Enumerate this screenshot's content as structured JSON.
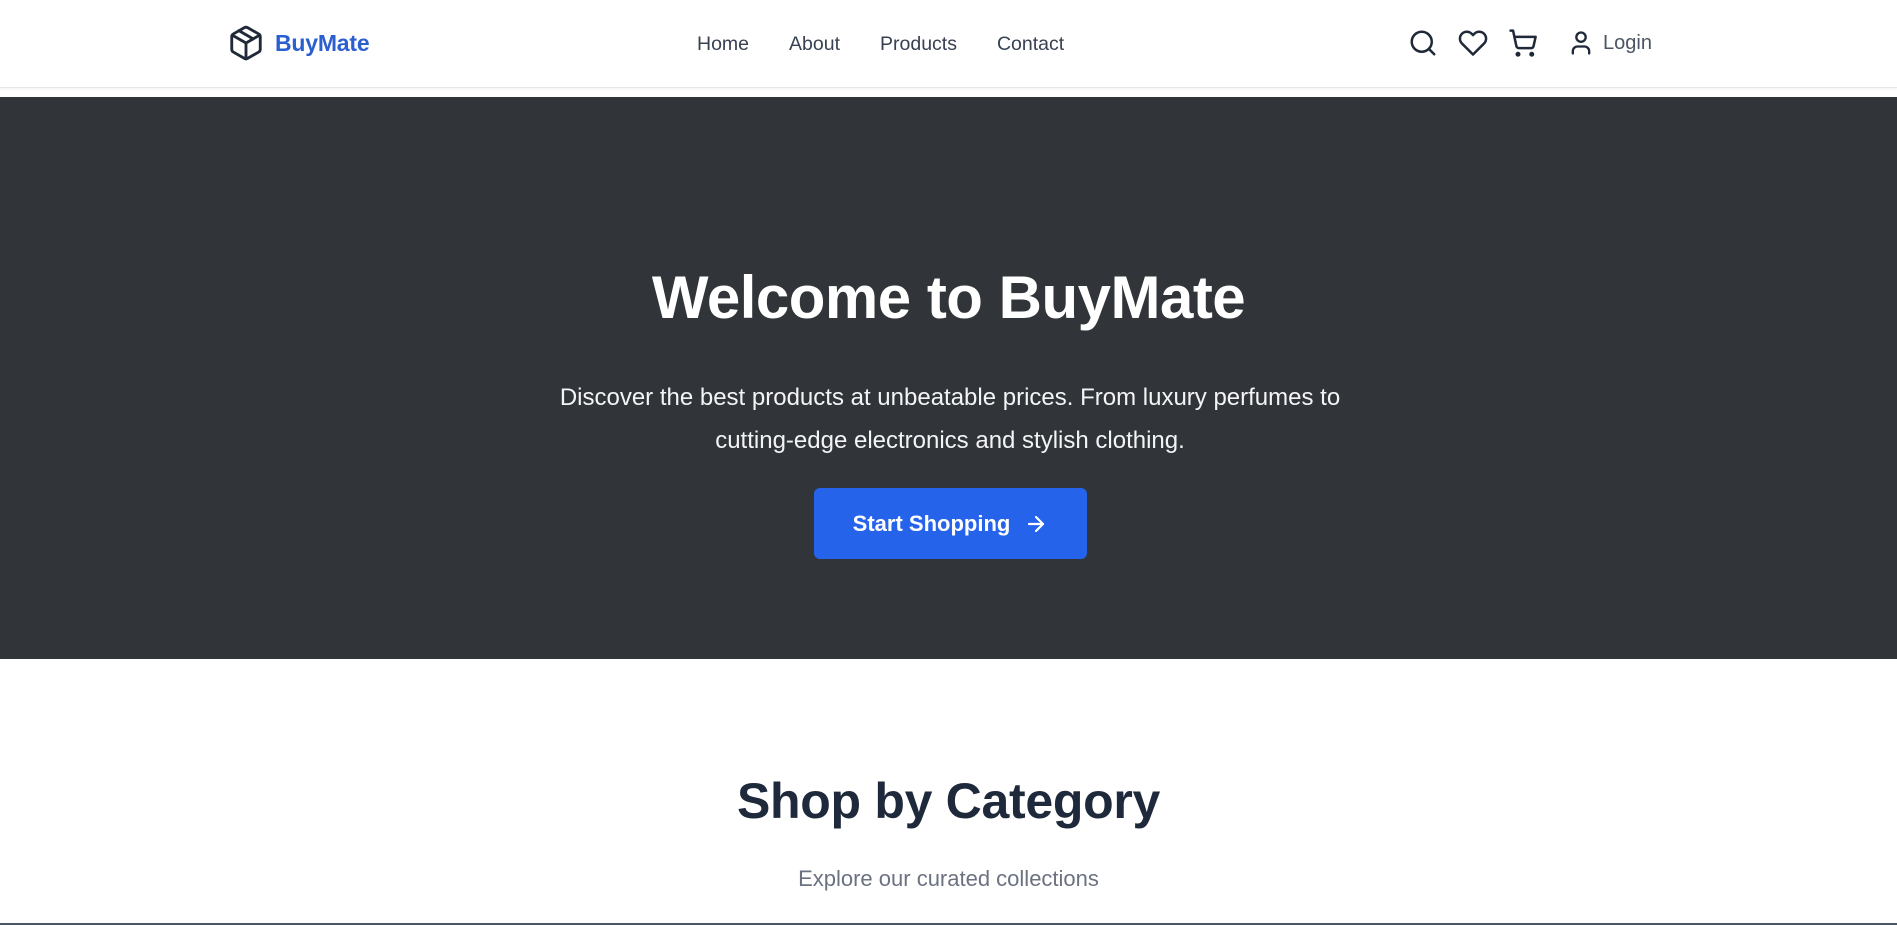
{
  "header": {
    "brand_name": "BuyMate",
    "brand_icon": "package-box-icon",
    "nav": [
      {
        "label": "Home"
      },
      {
        "label": "About"
      },
      {
        "label": "Products"
      },
      {
        "label": "Contact"
      }
    ],
    "actions": {
      "search_icon": "search-icon",
      "wishlist_icon": "heart-icon",
      "cart_icon": "cart-icon",
      "login_icon": "user-icon",
      "login_label": "Login"
    }
  },
  "hero": {
    "title": "Welcome to BuyMate",
    "subtitle": "Discover the best products at unbeatable prices. From luxury perfumes to cutting-edge electronics and stylish clothing.",
    "cta_label": "Start Shopping",
    "cta_icon": "arrow-right-icon"
  },
  "category": {
    "title": "Shop by Category",
    "subtitle": "Explore our curated collections"
  },
  "colors": {
    "brand": "#2b5fd0",
    "hero_background": "#313438",
    "cta_background": "#2663eb",
    "heading_dark": "#1e293b",
    "muted_text": "#6b7280"
  }
}
